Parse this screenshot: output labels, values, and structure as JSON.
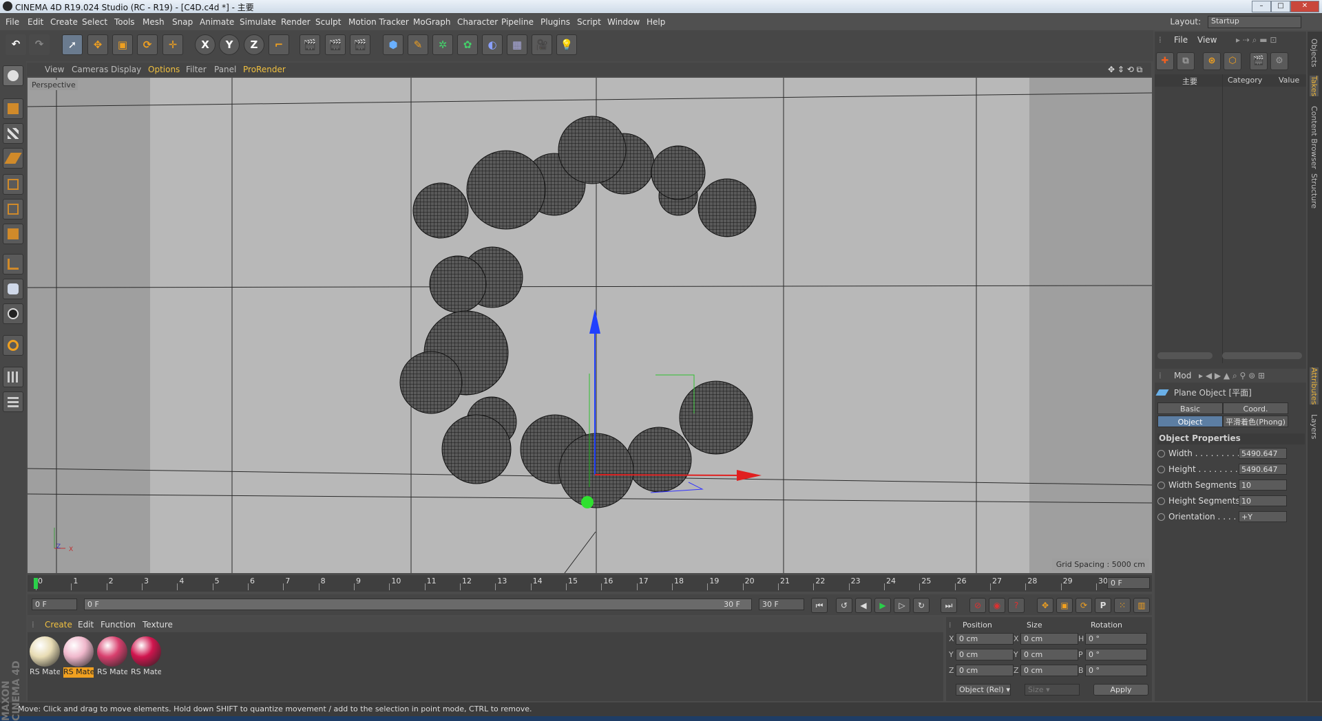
{
  "title_bar": {
    "title": "CINEMA 4D R19.024 Studio (RC - R19) - [C4D.c4d *] - 主要",
    "buttons": [
      "minimize",
      "maximize",
      "close"
    ]
  },
  "menu": [
    "File",
    "Edit",
    "Create",
    "Select",
    "Tools",
    "Mesh",
    "Snap",
    "Animate",
    "Simulate",
    "Render",
    "Sculpt",
    "Motion Tracker",
    "MoGraph",
    "Character",
    "Pipeline",
    "Plugins",
    "Script",
    "Window",
    "Help"
  ],
  "layout": {
    "label": "Layout:",
    "value": "Startup"
  },
  "toolbar": {
    "axis_x": "X",
    "axis_y": "Y",
    "axis_z": "Z"
  },
  "viewport": {
    "menu": [
      "View",
      "Cameras",
      "Display",
      "Options",
      "Filter",
      "Panel",
      "ProRender"
    ],
    "camera_label": "Perspective",
    "grid_spacing": "Grid Spacing : 5000 cm",
    "axis_labels": {
      "y": "Y",
      "z": "Z",
      "x": "X"
    }
  },
  "timeline": {
    "ticks": [
      "0",
      "1",
      "2",
      "3",
      "4",
      "5",
      "6",
      "7",
      "8",
      "9",
      "10",
      "11",
      "12",
      "13",
      "14",
      "15",
      "16",
      "17",
      "18",
      "19",
      "20",
      "21",
      "22",
      "23",
      "24",
      "25",
      "26",
      "27",
      "28",
      "29",
      "30"
    ],
    "current_frame": "0 F",
    "start_field": "0 F",
    "range_start": "0 F",
    "range_end": "30 F",
    "end_field": "30 F"
  },
  "materials": {
    "menu": [
      "Create",
      "Edit",
      "Function",
      "Texture"
    ],
    "items": [
      {
        "label": "RS Mate",
        "color": "#e8dcb4",
        "selected": false
      },
      {
        "label": "RS Mate",
        "color": "#f0b8cc",
        "selected": true
      },
      {
        "label": "RS Mate",
        "color": "#d8406e",
        "selected": false
      },
      {
        "label": "RS Mate",
        "color": "#d0154e",
        "selected": false
      }
    ]
  },
  "coordinates": {
    "headers": [
      "Position",
      "Size",
      "Rotation"
    ],
    "rows": [
      {
        "pl": "X",
        "pv": "0 cm",
        "sl": "X",
        "sv": "0 cm",
        "rl": "H",
        "rv": "0 °"
      },
      {
        "pl": "Y",
        "pv": "0 cm",
        "sl": "Y",
        "sv": "0 cm",
        "rl": "P",
        "rv": "0 °"
      },
      {
        "pl": "Z",
        "pv": "0 cm",
        "sl": "Z",
        "sv": "0 cm",
        "rl": "B",
        "rv": "0 °"
      }
    ],
    "mode": "Object (Rel)",
    "size_mode": "Size",
    "apply": "Apply"
  },
  "status": "Move: Click and drag to move elements. Hold down SHIFT to quantize movement / add to the selection in point mode, CTRL to remove.",
  "object_panel": {
    "menu": [
      "File",
      "View"
    ],
    "takes_header": [
      "主要",
      "Category",
      "Value"
    ]
  },
  "attributes": {
    "menu": "Mod",
    "object_name": "Plane Object [平面]",
    "tabs": [
      {
        "label": "Basic",
        "active": false
      },
      {
        "label": "Coord.",
        "active": false
      },
      {
        "label": "Object",
        "active": true
      },
      {
        "label": "平滑着色(Phong)",
        "active": false
      }
    ],
    "section": "Object Properties",
    "props": [
      {
        "label": "Width . . . . . . . . . .",
        "value": "5490.647"
      },
      {
        "label": "Height . . . . . . . . .",
        "value": "5490.647"
      },
      {
        "label": "Width Segments",
        "value": "10"
      },
      {
        "label": "Height Segments",
        "value": "10"
      },
      {
        "label": "Orientation . . . . .",
        "value": "+Y"
      }
    ]
  },
  "side_tabs": [
    "Objects",
    "Takes",
    "Content Browser",
    "Structure",
    "Attributes",
    "Layers"
  ],
  "brand": "MAXON CINEMA 4D"
}
